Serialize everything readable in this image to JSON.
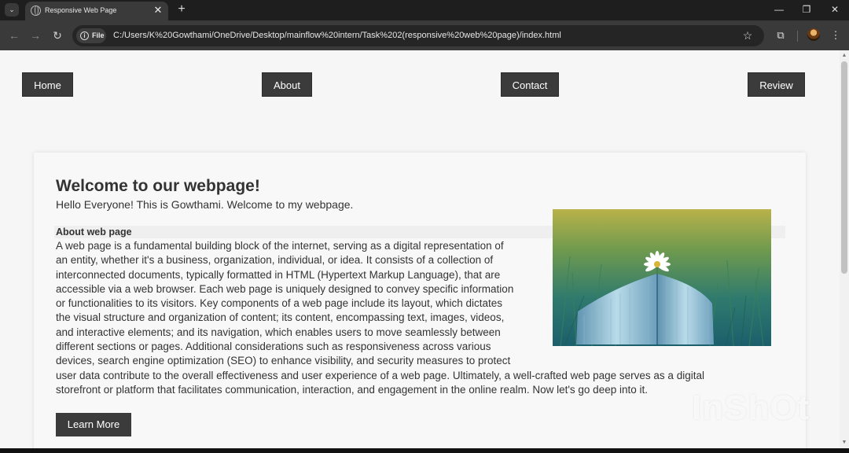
{
  "browser": {
    "tab_title": "Responsive Web Page",
    "close_glyph": "✕",
    "new_tab_glyph": "+",
    "tab_menu_glyph": "⌄",
    "address_chip": "File",
    "url": "C:/Users/K%20Gowthami/OneDrive/Desktop/mainflow%20intern/Task%202(responsive%20web%20page)/index.html",
    "icons": {
      "back": "←",
      "forward": "→",
      "reload": "↻",
      "star": "☆",
      "extensions": "⧉",
      "menu": "⋮",
      "minimize": "—",
      "restore": "❐",
      "close": "✕"
    }
  },
  "nav": {
    "items": [
      {
        "label": "Home"
      },
      {
        "label": "About"
      },
      {
        "label": "Contact"
      },
      {
        "label": "Review"
      }
    ]
  },
  "content": {
    "heading": "Welcome to our webpage!",
    "intro": "Hello Everyone! This is Gowthami. Welcome to my webpage.",
    "subheading": "About web page",
    "paragraph_lines": [
      "A web page is a fundamental building block of the internet, serving as a digital representation of",
      "an entity, whether it's a business, organization, individual, or idea. It consists of a collection of",
      "interconnected documents, typically formatted in HTML (Hypertext Markup Language), that are",
      "accessible via a web browser. Each web page is uniquely designed to convey specific information",
      "or functionalities to its visitors. Key components of a web page include its layout, which dictates",
      "the visual structure and organization of content; its content, encompassing text, images, videos,",
      "and interactive elements; and its navigation, which enables users to move seamlessly between",
      "different sections or pages. Additional considerations such as responsiveness across various",
      "devices, search engine optimization (SEO) to enhance visibility, and security measures to protect",
      "user data contribute to the overall effectiveness and user experience of a web page. Ultimately, a well-crafted web page serves as a digital",
      "storefront or platform that facilitates communication, interaction, and engagement in the online realm. Now let's go deep into it."
    ],
    "button_label": "Learn More"
  },
  "watermark": "InShOt",
  "colors": {
    "nav_button_bg": "#3b3b3b",
    "page_bg": "#f6f6f6",
    "text": "#333333"
  }
}
